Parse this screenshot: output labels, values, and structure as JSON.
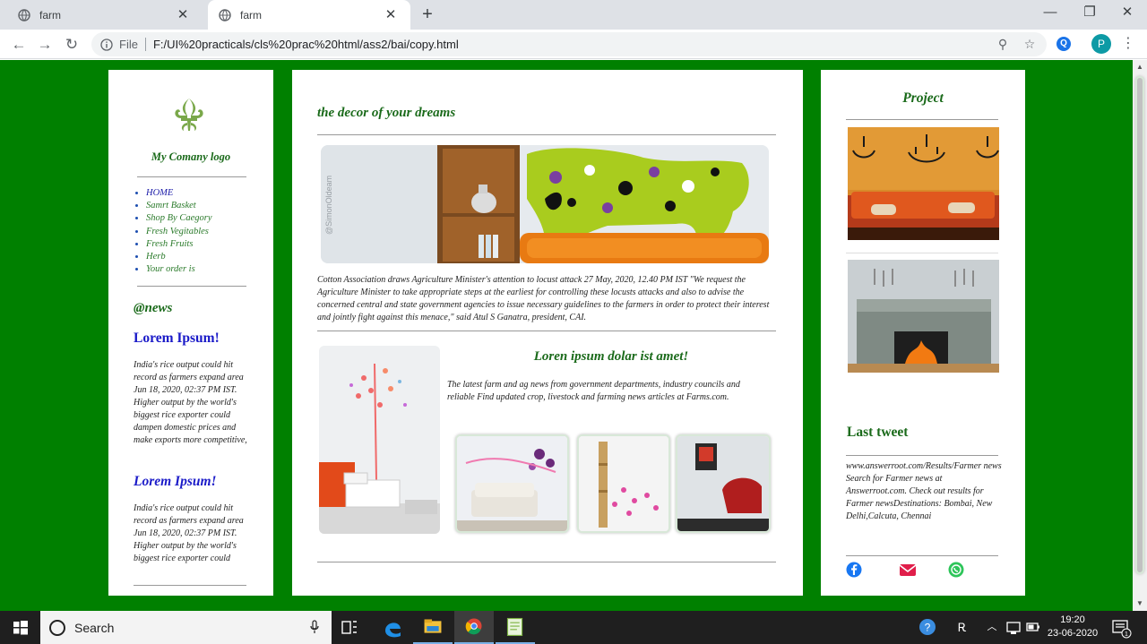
{
  "browser": {
    "tabs": [
      {
        "title": "farm",
        "active": false
      },
      {
        "title": "farm",
        "active": true
      }
    ],
    "new_tab_label": "+",
    "address": {
      "scheme_label": "File",
      "url": "F:/UI%20practicals/cls%20prac%20html/ass2/bai/copy.html"
    },
    "extension_label": "Q",
    "profile_initial": "P"
  },
  "page": {
    "colors": {
      "background": "#008000",
      "heading_green": "#1a6a1a",
      "link_blue": "#1a1ac8"
    },
    "logo": {
      "icon": "fleur-de-lis-icon",
      "text": "My Comany logo"
    },
    "nav": [
      "HOME",
      "Samrt Basket",
      "Shop By Caegory",
      "Fresh Vegitables",
      "Fresh Fruits",
      "Herb",
      "Your order is"
    ],
    "news": {
      "heading": "@news",
      "items": [
        {
          "title": "Lorem Ipsum!",
          "text": "India's rice output could hit record as farmers expand area Jun 18, 2020, 02:37 PM IST. Higher output by the world's biggest rice exporter could dampen domestic prices and make exports more competitive,"
        },
        {
          "title": "Lorem Ipsum!",
          "text": "India's rice output could hit record as farmers expand area Jun 18, 2020, 02:37 PM IST. Higher output by the world's biggest rice exporter could"
        }
      ]
    },
    "main": {
      "title": "the decor of your dreams",
      "banner_watermark": "@SimonOldeam",
      "caption": "Cotton Association draws Agriculture Minister's attention to locust attack 27 May, 2020, 12.40 PM IST \"We request the Agriculture Minister to take appropriate steps at the earliest for controlling these locusts attacks and also to advise the concerned central and state government agencies to issue necessary guidelines to the farmers in order to protect their interest and jointly fight against this menace,\" said Atul S Ganatra, president, CAI.",
      "second_heading": "Loren ipsum dolar ist amet!",
      "second_text": "The latest farm and ag news from government departments, industry councils and reliable Find updated crop, livestock and farming news articles at Farms.com."
    },
    "right": {
      "project_heading": "Project",
      "tweet_heading": "Last tweet",
      "tweet_text": "www.answerroot.com/Results/Farmer news Search for Farmer news at Answerroot.com. Check out results for Farmer newsDestinations: Bombai, New Delhi,Calcuta, Chennai",
      "social": [
        "facebook-icon",
        "mail-icon",
        "whatsapp-icon"
      ]
    }
  },
  "taskbar": {
    "search_placeholder": "Search",
    "time": "19:20",
    "date": "23-06-2020",
    "notification_count": "1"
  }
}
